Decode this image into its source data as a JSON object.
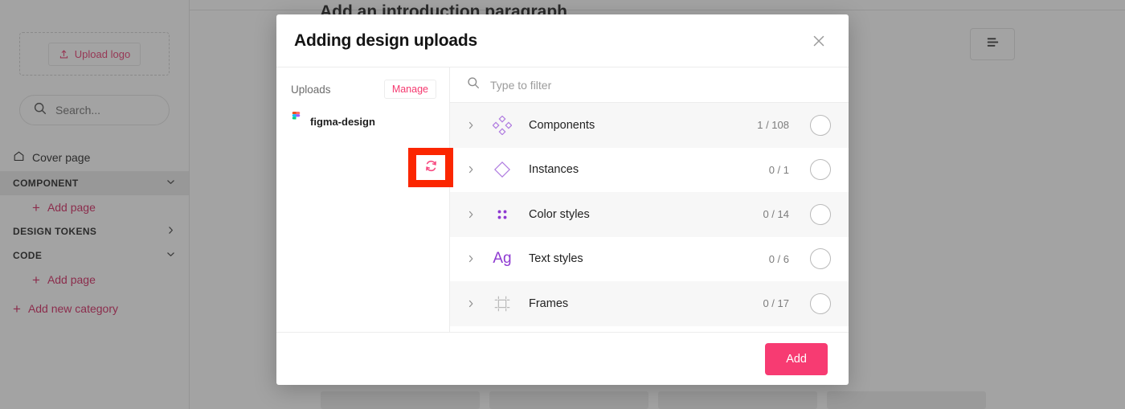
{
  "sidebar": {
    "upload_logo_label": "Upload logo",
    "search_placeholder": "Search...",
    "cover_page_label": "Cover page",
    "categories": [
      {
        "label": "COMPONENT",
        "state": "expanded",
        "add_page_label": "Add page"
      },
      {
        "label": "DESIGN TOKENS",
        "state": "collapsed"
      },
      {
        "label": "CODE",
        "state": "expanded",
        "add_page_label": "Add page"
      }
    ],
    "add_new_category_label": "Add new category",
    "accent_color": "#d1205c"
  },
  "page": {
    "title": "Add an introduction paragraph",
    "align_button_name": "text-align-button",
    "placeholder_cards": 4
  },
  "modal": {
    "title": "Adding design uploads",
    "close_label": "×",
    "uploads": {
      "label": "Uploads",
      "manage_label": "Manage",
      "items": [
        {
          "name": "figma-design",
          "source": "figma"
        }
      ],
      "refresh_tooltip": "refresh"
    },
    "filter": {
      "placeholder": "Type to filter",
      "value": ""
    },
    "rows": [
      {
        "label": "Components",
        "count": "1 / 108",
        "icon": "components-icon",
        "selected": false,
        "expandable": true
      },
      {
        "label": "Instances",
        "count": "0 / 1",
        "icon": "instances-icon",
        "selected": false,
        "expandable": true
      },
      {
        "label": "Color styles",
        "count": "0 / 14",
        "icon": "color-styles-icon",
        "selected": false,
        "expandable": true
      },
      {
        "label": "Text styles",
        "count": "0 / 6",
        "icon": "text-styles-icon",
        "selected": false,
        "expandable": true
      },
      {
        "label": "Frames",
        "count": "0 / 17",
        "icon": "frames-icon",
        "selected": false,
        "expandable": true
      }
    ],
    "footer": {
      "add_label": "Add"
    },
    "accent_color": "#f73b72"
  },
  "annotation": {
    "highlight_color": "#fb2600",
    "target": "refresh-uploads-button"
  }
}
